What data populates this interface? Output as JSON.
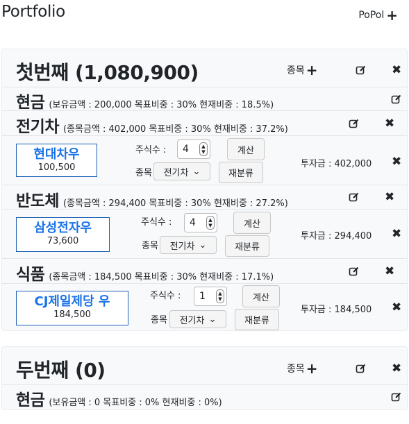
{
  "app": {
    "title": "Portfolio",
    "popol_label": "PoPol"
  },
  "portfolios": [
    {
      "name": "첫번째 (1,080,900)",
      "add_stock_label": "종목",
      "cash": {
        "label": "현금",
        "info": "(보유금액 : 200,000  목표비중 : 30%  현재비중 : 18.5%)"
      },
      "sectors": [
        {
          "name": "전기차",
          "info": "(종목금액 : 402,000  목표비중 : 30%  현재비중 : 37.2%)",
          "stock": {
            "name": "현대차우",
            "price": "100,500",
            "shares_label": "주식수 :",
            "shares": "4",
            "calc_label": "계산",
            "sector_label": "종목",
            "sector_value": "전기차",
            "reclass_label": "재분류",
            "invest": "투자금 : 402,000"
          }
        },
        {
          "name": "반도체",
          "info": "(종목금액 : 294,400  목표비중 : 30%  현재비중 : 27.2%)",
          "stock": {
            "name": "삼성전자우",
            "price": "73,600",
            "shares_label": "주식수 :",
            "shares": "4",
            "calc_label": "계산",
            "sector_label": "종목",
            "sector_value": "전기차",
            "reclass_label": "재분류",
            "invest": "투자금 : 294,400"
          }
        },
        {
          "name": "식품",
          "info": "(종목금액 : 184,500  목표비중 : 30%  현재비중 : 17.1%)",
          "stock": {
            "name": "CJ제일제당 우",
            "price": "184,500",
            "shares_label": "주식수 :",
            "shares": "1",
            "calc_label": "계산",
            "sector_label": "종목",
            "sector_value": "전기차",
            "reclass_label": "재분류",
            "invest": "투자금 : 184,500"
          }
        }
      ]
    },
    {
      "name": "두번째 (0)",
      "add_stock_label": "종목",
      "cash": {
        "label": "현금",
        "info": "(보유금액 : 0  목표비중 : 0%  현재비중 : 0%)"
      },
      "sectors": []
    }
  ],
  "icons": {
    "add": "plus-icon",
    "edit": "edit-icon",
    "delete": "close-icon",
    "spinner": "spinner-icon",
    "chevron": "chevron-down-icon"
  },
  "colors": {
    "stock_link": "#1a73e8",
    "stock_border": "#1a5eb5",
    "card_bg": "#f8f9fa"
  }
}
